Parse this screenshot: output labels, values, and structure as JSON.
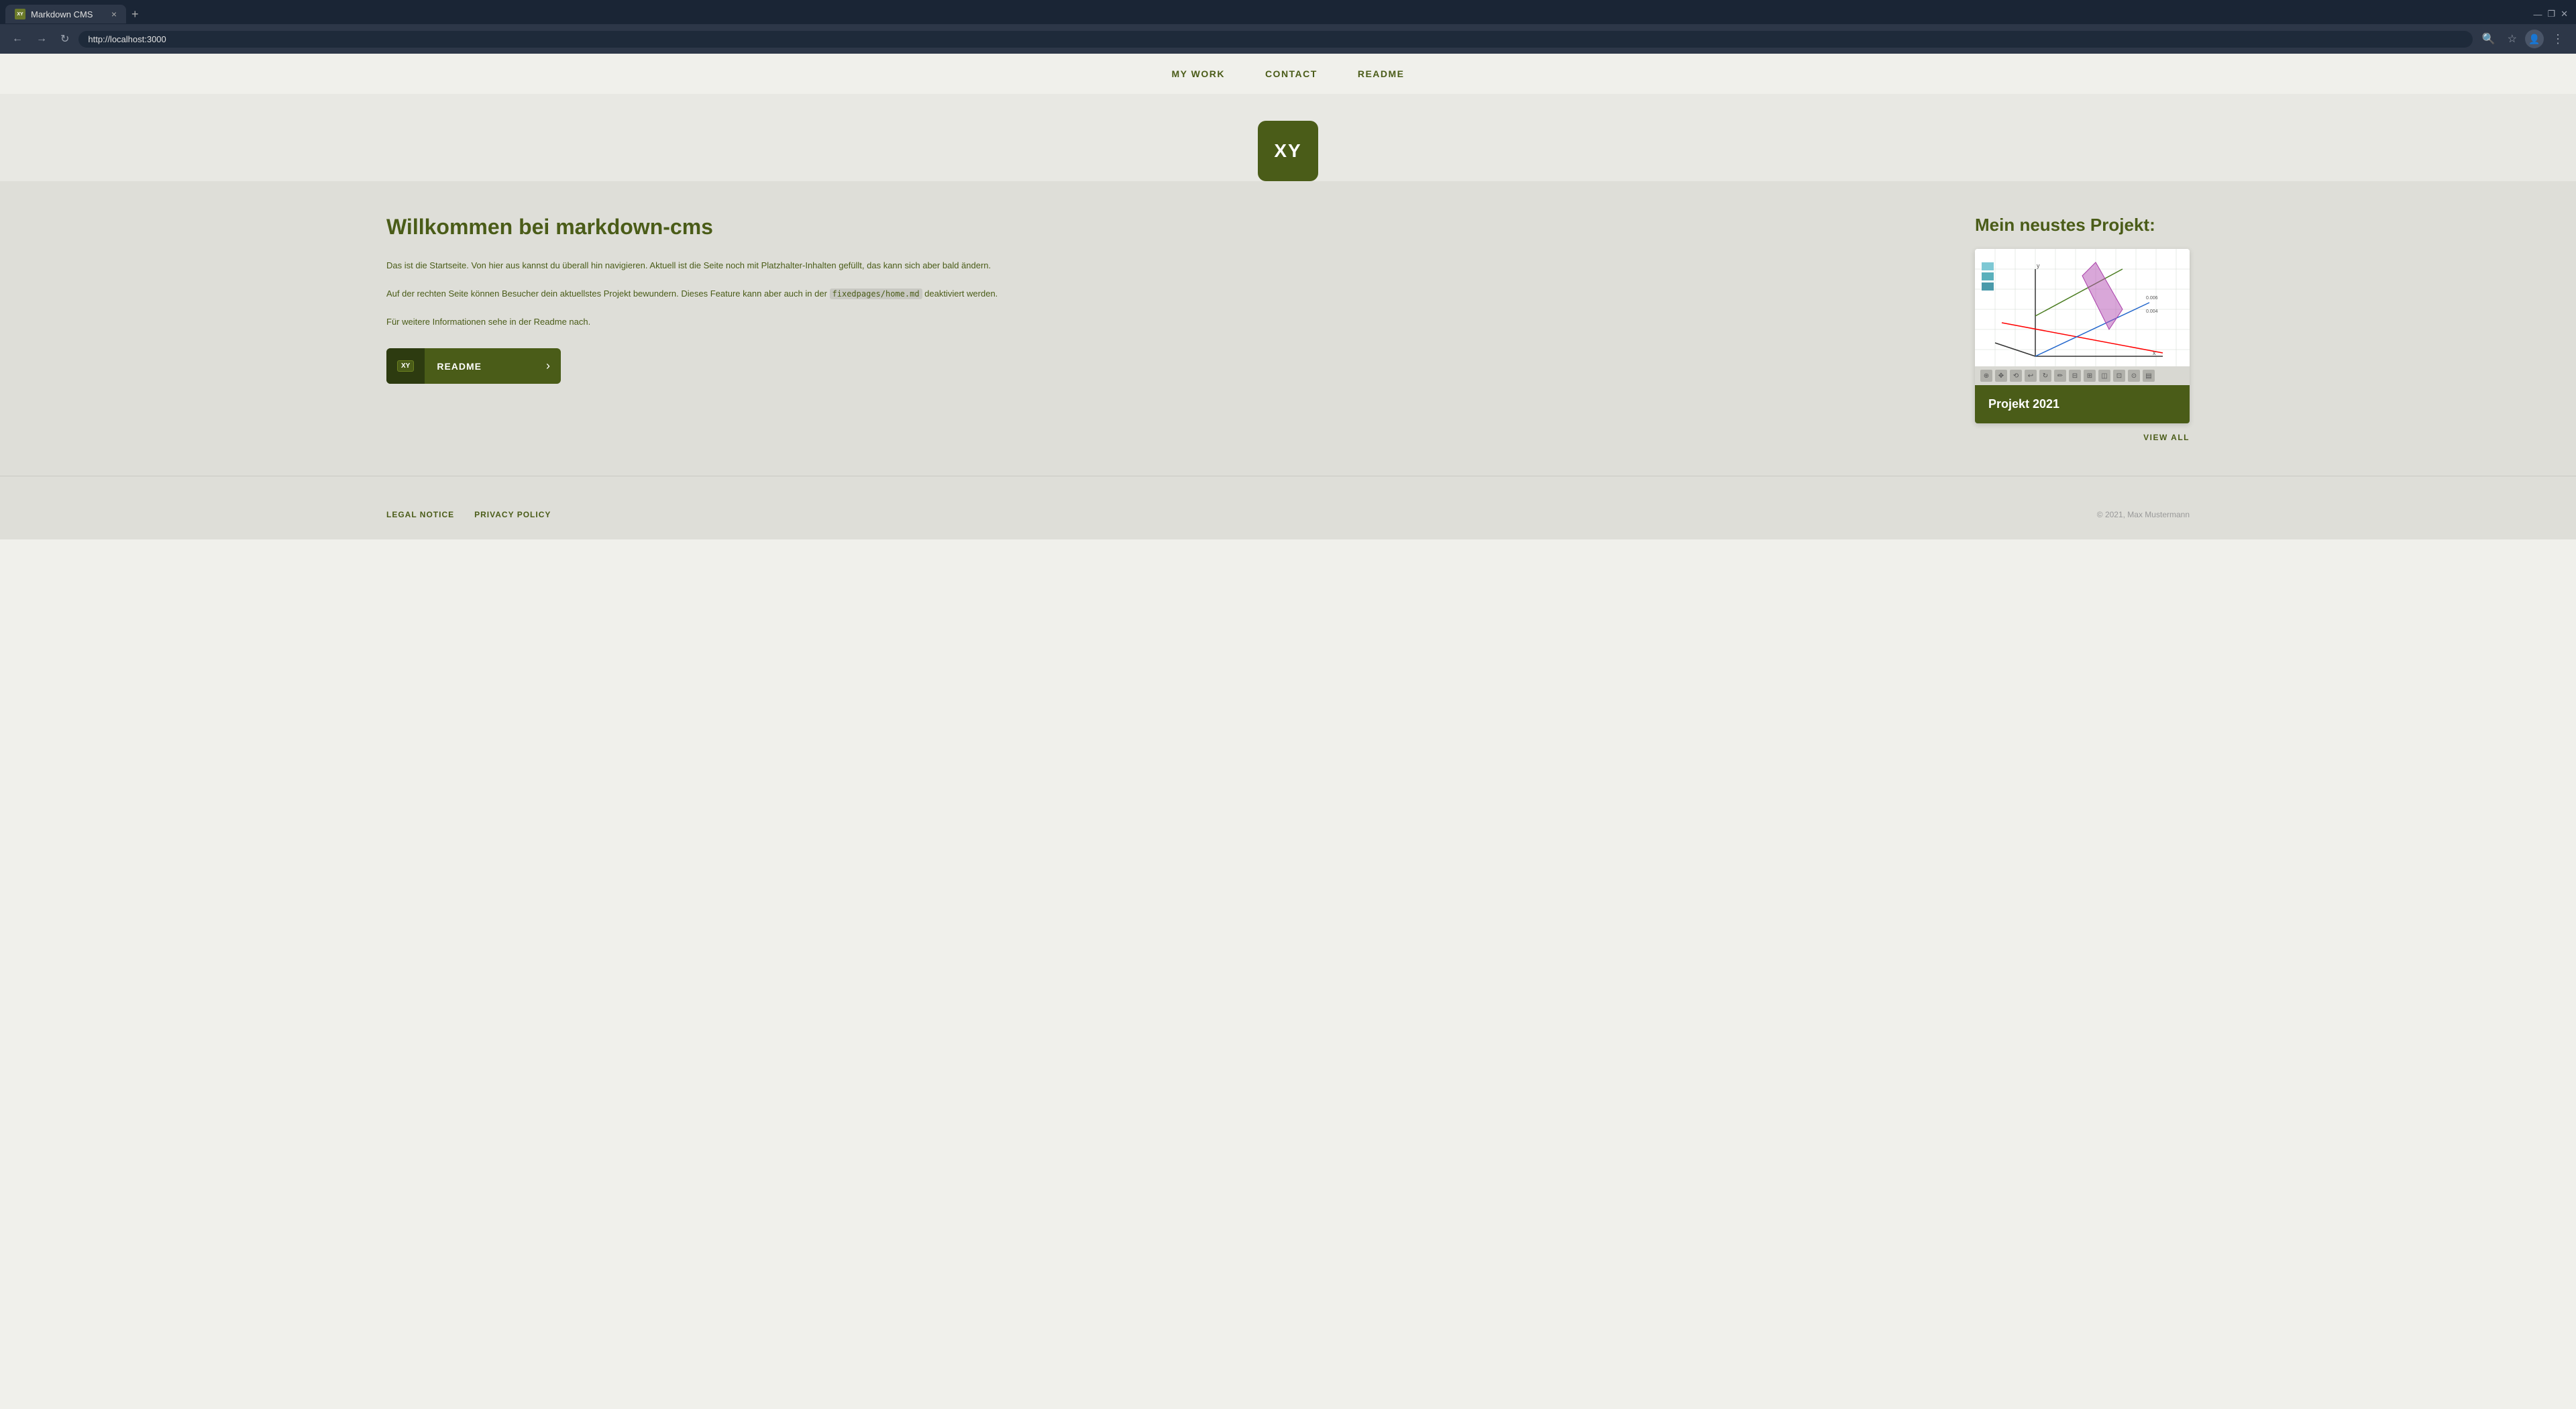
{
  "browser": {
    "tab_favicon": "XY",
    "tab_title": "Markdown CMS",
    "tab_close": "×",
    "tab_new": "+",
    "back_btn": "←",
    "forward_btn": "→",
    "refresh_btn": "↻",
    "url": "http://localhost:3000",
    "search_icon": "🔍",
    "star_icon": "☆",
    "menu_icon": "⋮"
  },
  "nav": {
    "items": [
      {
        "label": "MY WORK",
        "id": "my-work"
      },
      {
        "label": "CONTACT",
        "id": "contact"
      },
      {
        "label": "README",
        "id": "readme"
      }
    ]
  },
  "logo": {
    "text": "XY"
  },
  "main": {
    "title": "Willkommen bei markdown-cms",
    "paragraphs": [
      "Das ist die Startseite. Von hier aus kannst du überall hin navigieren. Aktuell ist die Seite noch mit Platzhalter-Inhalten gefüllt, das kann sich aber bald ändern.",
      "Auf der rechten Seite können Besucher dein aktuellstes Projekt bewundern. Dieses Feature kann aber auch in der fixedpages/home.md deaktiviert werden.",
      "Für weitere Informationen sehe in der Readme nach."
    ],
    "code_inline": "fixedpages/home.md",
    "readme_btn": {
      "icon_text": "XY",
      "label": "README",
      "arrow": "›"
    }
  },
  "project": {
    "section_title": "Mein neustes Projekt:",
    "card_title": "Projekt 2021",
    "view_all": "VIEW ALL"
  },
  "footer": {
    "links": [
      {
        "label": "LEGAL NOTICE"
      },
      {
        "label": "PRIVACY POLICY"
      }
    ],
    "copyright": "© 2021, Max Mustermann"
  }
}
